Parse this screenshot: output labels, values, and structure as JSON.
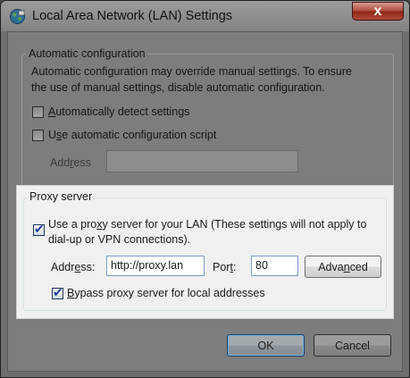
{
  "window": {
    "title": "Local Area Network (LAN) Settings",
    "close_glyph": "x"
  },
  "auto_config": {
    "group_label": "Automatic configuration",
    "description_line1": "Automatic configuration may override manual settings.  To ensure",
    "description_line2": "the use of manual settings, disable automatic configuration.",
    "detect_settings": {
      "label_accel": "A",
      "label_rest": "utomatically detect settings",
      "checked": false
    },
    "use_script": {
      "label_pre": "U",
      "label_accel": "s",
      "label_rest": "e automatic configuration script",
      "checked": false
    },
    "address_label_pre": "Add",
    "address_label_accel": "r",
    "address_label_rest": "ess",
    "address_value": ""
  },
  "proxy": {
    "group_label": "Proxy server",
    "use_proxy": {
      "label_line1_pre": "Use a pro",
      "label_line1_accel": "x",
      "label_line1_rest": "y server for your LAN (These settings will not apply to",
      "label_line2": "dial-up or VPN connections).",
      "checked": true
    },
    "address_label_pre": "Addr",
    "address_label_accel": "e",
    "address_label_rest": "ss:",
    "address_value": "http://proxy.lan",
    "port_label_pre": "Por",
    "port_label_accel": "t",
    "port_label_rest": ":",
    "port_value": "80",
    "advanced_label_pre": "Adva",
    "advanced_label_accel": "n",
    "advanced_label_rest": "ced",
    "bypass": {
      "label_accel": "B",
      "label_rest": "ypass proxy server for local addresses",
      "checked": true
    }
  },
  "buttons": {
    "ok_label": "OK",
    "cancel_label": "Cancel"
  },
  "icons": {
    "app": "globe-network-icon",
    "close": "close-icon",
    "check": "checkmark-icon"
  },
  "colors": {
    "close_button": "#b04a3b",
    "checkmark": "#21409a",
    "dimmed_overlay": "#7d7d7d",
    "highlight_panel": "#f0f0f0"
  }
}
